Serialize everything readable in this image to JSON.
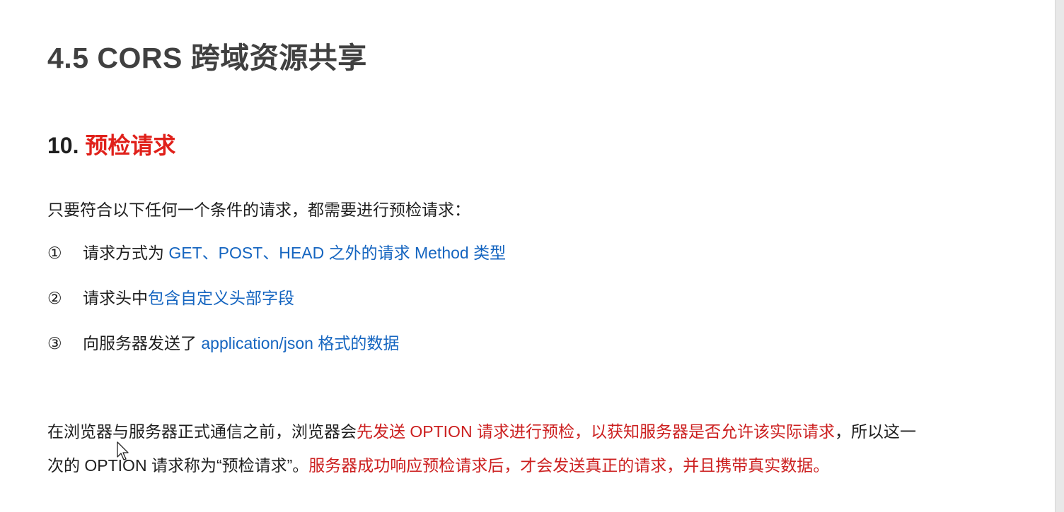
{
  "page": {
    "title": "4.5 CORS 跨域资源共享"
  },
  "section": {
    "number": "10.",
    "title": "预检请求"
  },
  "intro": "只要符合以下任何一个条件的请求，都需要进行预检请求：",
  "conditions": [
    {
      "num": "①",
      "plain": "请求方式为 ",
      "highlight": "GET、POST、HEAD 之外的请求 Method 类型"
    },
    {
      "num": "②",
      "plain": "请求头中",
      "highlight": "包含自定义头部字段"
    },
    {
      "num": "③",
      "plain": "向服务器发送了 ",
      "highlight": "application/json 格式的数据"
    }
  ],
  "explanation": {
    "line1_plain": "在浏览器与服务器正式通信之前，浏览器会",
    "line1_red": "先发送 OPTION 请求进行预检，以获知服务器是否允许该实际请求",
    "line1_tail": "，所以这一",
    "line2_plain": "次的 OPTION 请求称为“预检请求”。",
    "line2_red": "服务器成功响应预检请求后，才会发送真正的请求，并且携带真实数据。"
  },
  "colors": {
    "title": "#404040",
    "accent_red": "#e0201a",
    "highlight_blue": "#1565c0",
    "highlight_red": "#cc2020",
    "body_text": "#1f1f1f"
  },
  "icons": {
    "cursor": "mouse-pointer-icon"
  }
}
